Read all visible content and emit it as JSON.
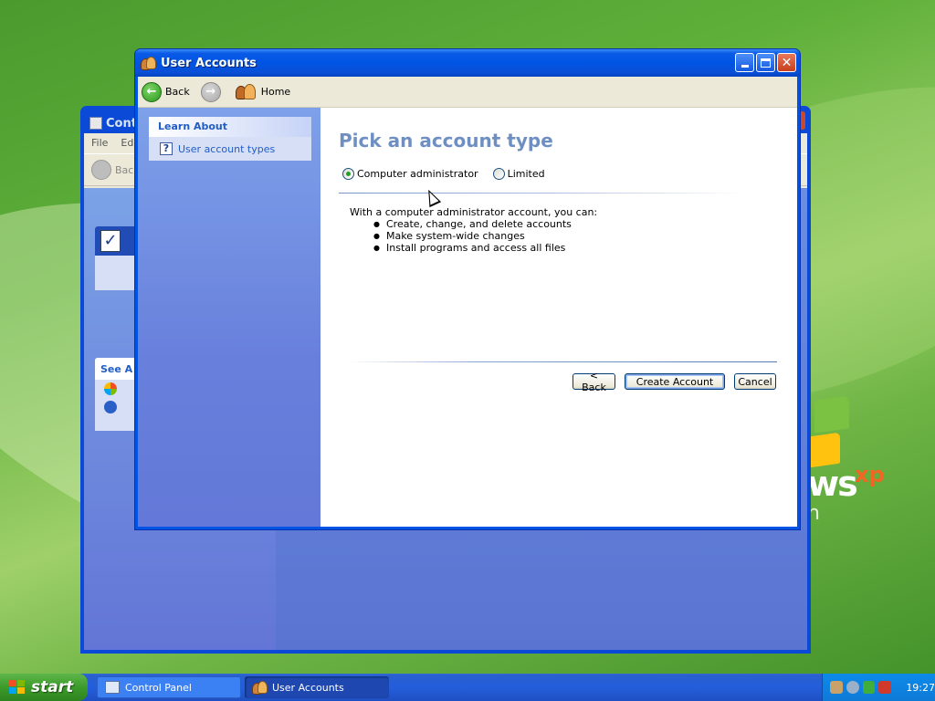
{
  "window": {
    "title": "User Accounts",
    "buttons": {
      "minimize": "minimize",
      "maximize": "maximize",
      "close": "close"
    }
  },
  "toolbar": {
    "back_label": "Back",
    "home_label": "Home"
  },
  "sidebar": {
    "learn_about_header": "Learn About",
    "items": [
      {
        "label": "User account types",
        "icon": "help-icon"
      }
    ]
  },
  "content": {
    "heading": "Pick an account type",
    "options": [
      {
        "label": "Computer administrator",
        "selected": true
      },
      {
        "label": "Limited",
        "selected": false
      }
    ],
    "description_intro": "With a computer administrator account, you can:",
    "capabilities": [
      "Create, change, and delete accounts",
      "Make system-wide changes",
      "Install programs and access all files"
    ],
    "buttons": {
      "back": "< Back",
      "create": "Create Account",
      "cancel": "Cancel"
    }
  },
  "background_window": {
    "title": "Contr",
    "menu": [
      "File",
      "Edi"
    ],
    "toolbar_back": "Bac",
    "see_also_header": "See A"
  },
  "desktop": {
    "logo_text": "ws",
    "logo_sup": "xp",
    "logo_sub": "n"
  },
  "taskbar": {
    "start_label": "start",
    "tasks": [
      {
        "label": "Control Panel",
        "active": false
      },
      {
        "label": "User Accounts",
        "active": true
      }
    ],
    "clock": "19:27"
  },
  "colors": {
    "title_bar": "#0054e3",
    "heading": "#6f8fc2",
    "task_pane": "#6880dc",
    "start_button": "#3c9a2a"
  }
}
